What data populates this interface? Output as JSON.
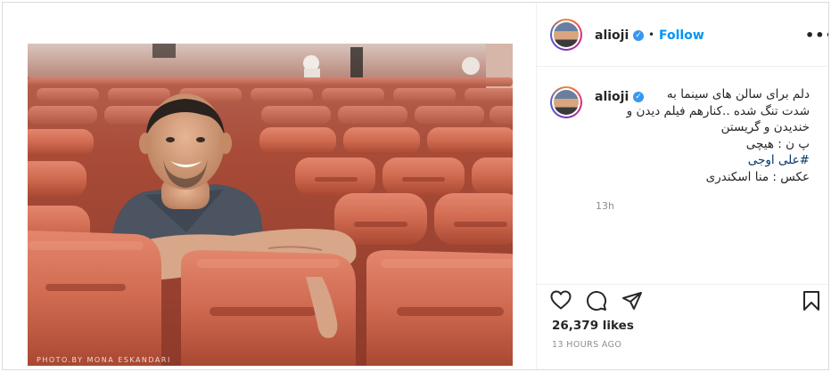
{
  "post": {
    "photo_credit": "PHOTO.BY   MONA ESKANDARI",
    "username": "alioji",
    "verified_mark": "✓",
    "separator": "•",
    "follow_label": "Follow",
    "more_label": "•••",
    "caption": {
      "line1": "دلم برای سالن های سینما به",
      "line2": "شدت تنگ شده ..کنارهم فیلم دیدن و",
      "line3": "خندیدن و گریستن",
      "line4": "پ ن : هیچی",
      "line5": "#علی اوجی",
      "line6": "عکس : منا اسکندری"
    },
    "caption_time": "13h",
    "likes": "26,379 likes",
    "posted_ago": "13 HOURS AGO",
    "icons": {
      "like": "heart-icon",
      "comment": "comment-icon",
      "share": "share-icon",
      "save": "bookmark-icon",
      "verified": "verified-badge-icon",
      "more": "more-options-icon"
    },
    "colors": {
      "follow": "#0095f6",
      "verified": "#3897f0",
      "seats": "#c8604a"
    }
  }
}
